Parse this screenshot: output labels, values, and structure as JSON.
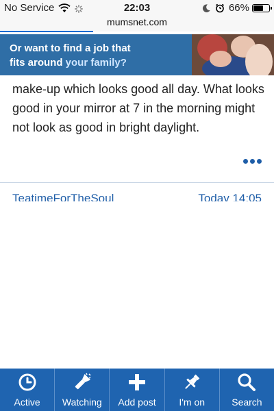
{
  "status_bar": {
    "carrier": "No Service",
    "time": "22:03",
    "battery_percent": "66%",
    "battery_level": 0.66
  },
  "browser": {
    "url": "mumsnet.com",
    "load_progress": 0.34
  },
  "ad_banner": {
    "line1": "Or want to find a job that",
    "line2_prefix": "fits around ",
    "line2_highlight": "your family?"
  },
  "post": {
    "body": "make-up which looks good all day. What looks good in your mirror at 7 in the morning might not look as good in bright daylight."
  },
  "next_post": {
    "username": "TeatimeForTheSoul",
    "timestamp": "Today 14:05"
  },
  "bottom_nav": {
    "items": [
      {
        "label": "Active",
        "icon": "clock-icon"
      },
      {
        "label": "Watching",
        "icon": "flashlight-icon"
      },
      {
        "label": "Add post",
        "icon": "plus-icon"
      },
      {
        "label": "I'm on",
        "icon": "pin-icon"
      },
      {
        "label": "Search",
        "icon": "search-icon"
      }
    ]
  },
  "colors": {
    "nav_background": "#1f64b0",
    "accent_blue": "#1f5ea8",
    "ad_background": "#2f6ea6"
  }
}
